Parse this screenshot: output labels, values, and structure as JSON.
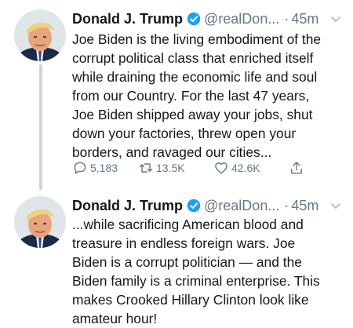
{
  "tweets": [
    {
      "author": {
        "name": "Donald J. Trump",
        "handle": "@realDon...",
        "verified": true
      },
      "separator": "·",
      "time": "45m",
      "text": "Joe Biden is the living embodiment of the\ncorrupt political class that enriched itself\nwhile draining the economic life and soul\nfrom our Country. For the last 47 years,\nJoe Biden shipped away your jobs, shut\ndown your factories, threw open your\nborders, and ravaged our cities...",
      "stats": {
        "replies": "5,183",
        "retweets": "13.5K",
        "likes": "42.6K"
      }
    },
    {
      "author": {
        "name": "Donald J. Trump",
        "handle": "@realDon...",
        "verified": true
      },
      "separator": "·",
      "time": "45m",
      "text": "...while sacrificing American blood and\ntreasure in endless foreign wars. Joe\nBiden is a corrupt politician — and the\nBiden family is a criminal enterprise. This\nmakes Crooked Hillary Clinton look like\namateur hour!"
    }
  ],
  "colors": {
    "text_primary": "#14171a",
    "text_secondary": "#657786",
    "verified_blue": "#1da1f2",
    "thread_line": "#ccd6dd"
  },
  "icons": [
    "avatar-photo",
    "verified-badge-icon",
    "chevron-down-icon",
    "reply-icon",
    "retweet-icon",
    "like-icon",
    "share-icon"
  ]
}
